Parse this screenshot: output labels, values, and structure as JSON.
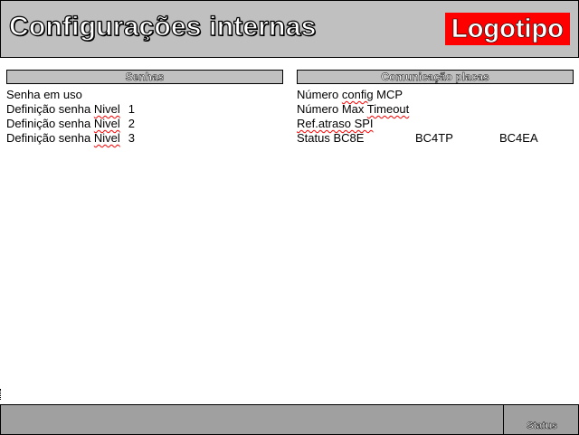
{
  "header": {
    "title": "Configurações internas",
    "logo_text": "Logotipo"
  },
  "senhas": {
    "heading": "Senhas",
    "senha_em_uso": "Senha em uso",
    "definicao_prefix": "Definição senha ",
    "nivel_word": "Nivel",
    "nivel_1": "1",
    "nivel_2": "2",
    "nivel_3": "3"
  },
  "comunicacao": {
    "heading": "Comunicação placas",
    "numero_prefix": "Número ",
    "config_word": "config",
    "mcp_suffix": " MCP",
    "numero_max_prefix": "Número Max ",
    "timeout_word": "Timeout",
    "ref_atraso": "Ref.atraso SPI",
    "status_bc8e": "Status BC8E",
    "bc4tp": "BC4TP",
    "bc4ea": "BC4EA"
  },
  "footer": {
    "status_label": "Status"
  },
  "colors": {
    "panel_gray": "#c0c0c0",
    "footer_gray": "#a0a0a0",
    "logo_red": "#ff0000"
  }
}
